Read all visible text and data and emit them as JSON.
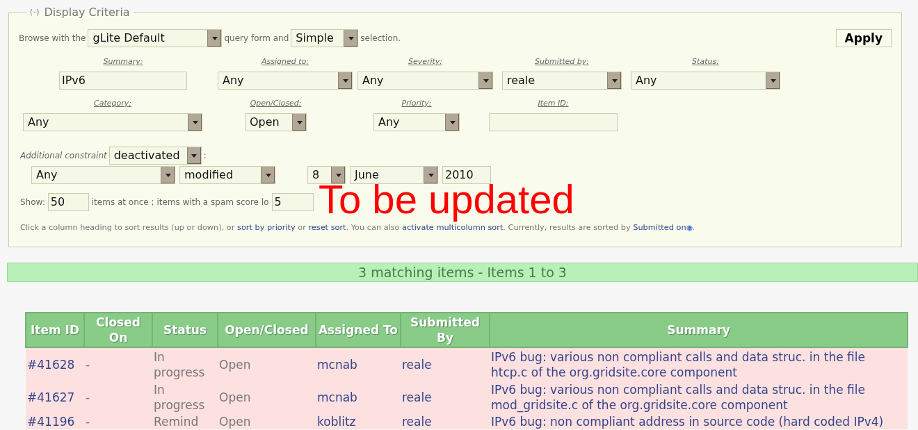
{
  "legend": {
    "toggle": "(-)",
    "title": "Display Criteria"
  },
  "browse": {
    "prefix": "Browse with the",
    "query_form": "gLite Default",
    "middle": "query form and",
    "selection": "Simple",
    "suffix": "selection."
  },
  "apply_button": "Apply",
  "filter_rows": [
    [
      {
        "label": "Summary:",
        "kind": "text",
        "value": "IPv6"
      },
      {
        "label": "Assigned to:",
        "kind": "select",
        "value": "Any"
      },
      {
        "label": "Severity:",
        "kind": "select",
        "value": "Any"
      },
      {
        "label": "Submitted by:",
        "kind": "select",
        "value": "reale"
      },
      {
        "label": "Status:",
        "kind": "select",
        "value": "Any"
      }
    ],
    [
      {
        "label": "Category:",
        "kind": "select",
        "value": "Any"
      },
      {
        "label": "Open/Closed:",
        "kind": "select",
        "value": "Open"
      },
      {
        "label": "Priority:",
        "kind": "select",
        "value": "Any"
      },
      {
        "label": "Item ID:",
        "kind": "text"
      }
    ]
  ],
  "additional": {
    "label": "Additional constraint",
    "mode": "deactivated",
    "colon": ":",
    "fields": [
      {
        "kind": "select",
        "value": "Any"
      },
      {
        "kind": "select",
        "value": "modified"
      },
      {
        "kind": "select",
        "value": "8"
      },
      {
        "kind": "select",
        "value": "June"
      },
      {
        "kind": "text",
        "value": "2010"
      }
    ]
  },
  "show": {
    "label": "Show:",
    "count": "50",
    "middle": "items at once ; items with a spam score lo",
    "score": "5"
  },
  "sort_note": [
    {
      "text": "Click a column heading to sort results (up or down), or ",
      "link": false
    },
    {
      "text": "sort by priority",
      "link": true
    },
    {
      "text": " or ",
      "link": false
    },
    {
      "text": "reset sort",
      "link": true
    },
    {
      "text": ". You can also ",
      "link": false
    },
    {
      "text": "activate multicolumn sort",
      "link": true
    },
    {
      "text": ". Currently, results are sorted by ",
      "link": false
    },
    {
      "text": "Submitted on",
      "link": true,
      "icon": true
    },
    {
      "text": ".",
      "link": false
    }
  ],
  "results_bar": "3 matching items - Items 1 to 3",
  "table": {
    "columns": [
      "Item ID",
      "Closed On",
      "Status",
      "Open/Closed",
      "Assigned To",
      "Submitted By",
      "Summary"
    ],
    "rows": [
      {
        "item_id": "#41628",
        "closed_on": "-",
        "status": "In progress",
        "open_closed": "Open",
        "assigned_to": "mcnab",
        "submitted_by": "reale",
        "summary": "IPv6 bug: various non compliant calls and data struc. in the file htcp.c of the org.gridsite.core component"
      },
      {
        "item_id": "#41627",
        "closed_on": "-",
        "status": "In progress",
        "open_closed": "Open",
        "assigned_to": "mcnab",
        "submitted_by": "reale",
        "summary": "IPv6 bug: various non compliant calls and data struc. in the file mod_gridsite.c of the org.gridsite.core component"
      },
      {
        "item_id": "#41196",
        "closed_on": "-",
        "status": "Remind",
        "open_closed": "Open",
        "assigned_to": "koblitz",
        "submitted_by": "reale",
        "summary": "IPv6 bug: non compliant address in source code (hard coded IPv4)"
      }
    ]
  },
  "annotation": "To be updated"
}
